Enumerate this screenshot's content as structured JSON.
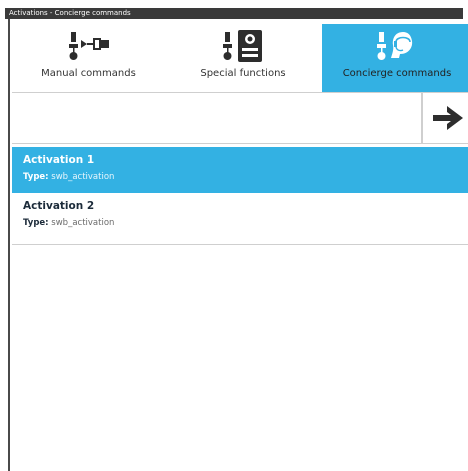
{
  "window": {
    "title": "Activations - Concierge commands"
  },
  "tabs": [
    {
      "label": "Manual commands",
      "icon": "manual-commands-icon"
    },
    {
      "label": "Special functions",
      "icon": "special-functions-icon"
    },
    {
      "label": "Concierge commands",
      "icon": "concierge-commands-icon",
      "selected": true
    }
  ],
  "search": {
    "value": "",
    "placeholder": ""
  },
  "go_button": {
    "icon": "arrow-right-icon"
  },
  "list": {
    "type_key": "Type:",
    "items": [
      {
        "name": "Activation 1",
        "type": "swb_activation",
        "selected": true
      },
      {
        "name": "Activation 2",
        "type": "swb_activation",
        "selected": false
      }
    ]
  },
  "colors": {
    "accent": "#33b1e3",
    "titlebar": "#3a3a3a",
    "text_dark": "#1c2b3a"
  }
}
